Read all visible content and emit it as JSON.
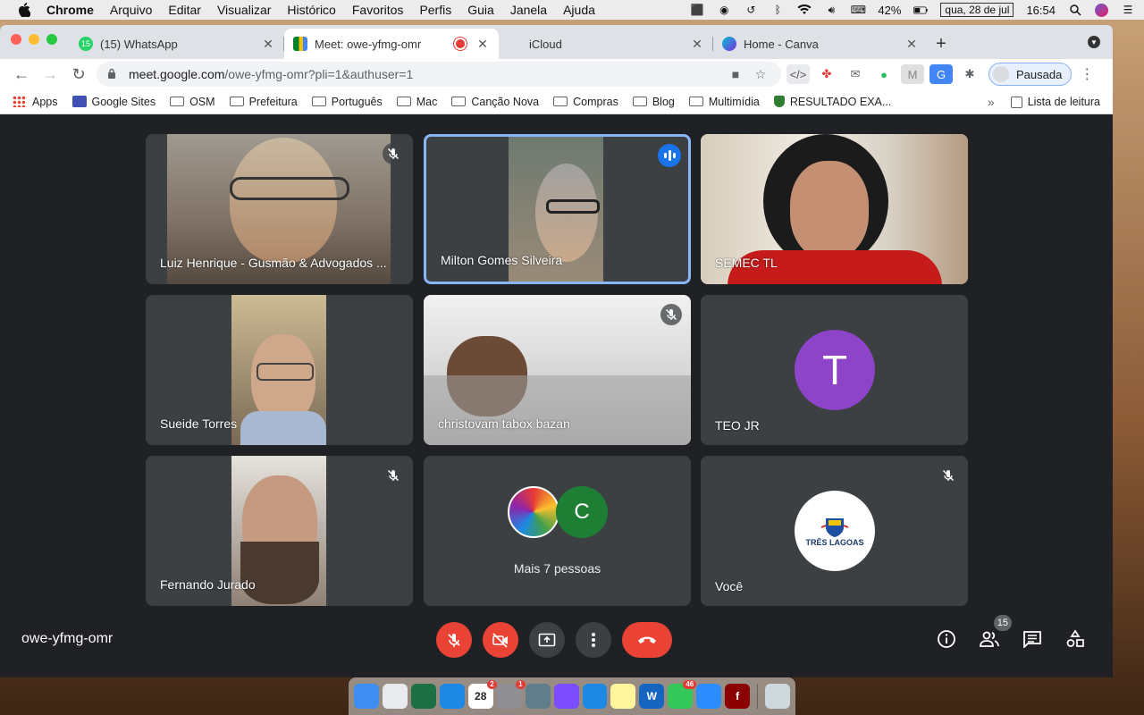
{
  "menubar": {
    "app": "Chrome",
    "menus": [
      "Arquivo",
      "Editar",
      "Visualizar",
      "Histórico",
      "Favoritos",
      "Perfis",
      "Guia",
      "Janela",
      "Ajuda"
    ],
    "battery": "42%",
    "date": "qua, 28 de jul",
    "time": "16:54"
  },
  "tabs": [
    {
      "title": "(15) WhatsApp",
      "badge": "15",
      "icon": "whatsapp-icon",
      "color": "#25d366"
    },
    {
      "title": "Meet: owe-yfmg-omr",
      "icon": "meet-icon",
      "color": "#00897b",
      "active": true
    },
    {
      "title": "iCloud",
      "icon": "apple-icon",
      "color": "#888888"
    },
    {
      "title": "Home - Canva",
      "icon": "canva-icon",
      "color": "#7d2ae8"
    }
  ],
  "toolbar": {
    "url_host": "meet.google.com",
    "url_path": "/owe-yfmg-omr?pli=1&authuser=1",
    "profile_label": "Pausada"
  },
  "bookmarks": {
    "items": [
      "Apps",
      "Google Sites",
      "OSM",
      "Prefeitura",
      "Português",
      "Mac",
      "Canção Nova",
      "Compras",
      "Blog",
      "Multimídia",
      "RESULTADO EXA..."
    ],
    "reading_list": "Lista de leitura"
  },
  "meet": {
    "participants": [
      {
        "name": "Luiz Henrique - Gusmão & Advogados ...",
        "muted": true
      },
      {
        "name": "Milton Gomes Silveira",
        "speaking": true
      },
      {
        "name": "SEMEC TL"
      },
      {
        "name": "Sueide Torres"
      },
      {
        "name": "christovam tabox bazan",
        "muted": true
      },
      {
        "name": "TEO JR",
        "initial": "T",
        "avatar_color": "#8e44c8"
      },
      {
        "name": "Fernando Jurado",
        "muted": true
      },
      {
        "more_label": "Mais 7 pessoas",
        "initial": "C",
        "avatar_color": "#1e7e34"
      },
      {
        "name": "Você",
        "muted": true,
        "logo_text": "TRÊS LAGOAS"
      }
    ],
    "meeting_code": "owe-yfmg-omr",
    "people_count": "15"
  },
  "dock": {
    "apps": [
      {
        "icon": "finder-icon",
        "color": "#3d8ef0"
      },
      {
        "icon": "chrome-icon",
        "color": "#e8eaed"
      },
      {
        "icon": "excel-icon",
        "color": "#1d7044"
      },
      {
        "icon": "safari-icon",
        "color": "#1e88e5"
      },
      {
        "icon": "calendar-icon",
        "color": "#ffffff",
        "label": "28",
        "badge": "2"
      },
      {
        "icon": "system-preferences-icon",
        "color": "#8e8e93",
        "badge": "1"
      },
      {
        "icon": "scanner-icon",
        "color": "#607d8b"
      },
      {
        "icon": "affinity-icon",
        "color": "#7c4dff"
      },
      {
        "icon": "app-store-icon",
        "color": "#1e88e5"
      },
      {
        "icon": "notes-icon",
        "color": "#fff59d"
      },
      {
        "icon": "word-icon",
        "color": "#1565c0",
        "label": "W"
      },
      {
        "icon": "messages-icon",
        "color": "#34c759",
        "badge": "46"
      },
      {
        "icon": "zoom-icon",
        "color": "#2d8cff"
      },
      {
        "icon": "flash-icon",
        "color": "#8b0000",
        "label": "f"
      },
      {
        "icon": "trash-icon",
        "color": "#cfd8dc"
      }
    ]
  },
  "colors": {
    "meet_bg": "#202124",
    "tile_bg": "#3c4043",
    "red_button": "#ea4335",
    "speaking_blue": "#1a73e8"
  }
}
